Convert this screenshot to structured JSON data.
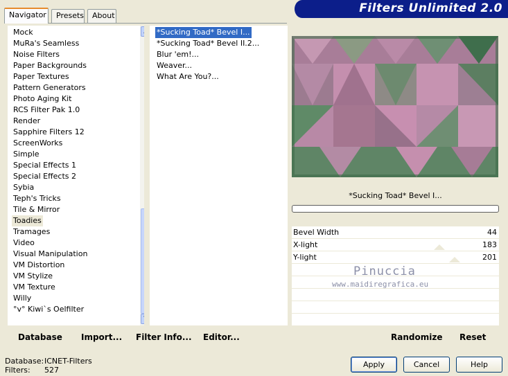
{
  "tabs": [
    {
      "label": "Navigator"
    },
    {
      "label": "Presets"
    },
    {
      "label": "About"
    }
  ],
  "app_title": "Filters Unlimited 2.0",
  "categories": [
    "Mock",
    "MuRa's Seamless",
    "Noise Filters",
    "Paper Backgrounds",
    "Paper Textures",
    "Pattern Generators",
    "Photo Aging Kit",
    "RCS Filter Pak 1.0",
    "Render",
    "Sapphire Filters 12",
    "ScreenWorks",
    "Simple",
    "Special Effects 1",
    "Special Effects 2",
    "Sybia",
    "Teph's Tricks",
    "Tile & Mirror",
    "Toadies",
    "Tramages",
    "Video",
    "Visual Manipulation",
    "VM Distortion",
    "VM Stylize",
    "VM Texture",
    "Willy",
    "°v° Kiwi`s Oelfilter"
  ],
  "selected_category": "Toadies",
  "filters": [
    "*Sucking Toad*  Bevel I...",
    "*Sucking Toad*  Bevel II.2...",
    "Blur 'em!...",
    "Weaver...",
    "What Are You?..."
  ],
  "preview_title": "*Sucking Toad*  Bevel I...",
  "params": [
    {
      "label": "Bevel Width",
      "value": "44"
    },
    {
      "label": "X-light",
      "value": "183"
    },
    {
      "label": "Y-light",
      "value": "201"
    }
  ],
  "watermark": {
    "line1": "Pinuccia",
    "line2": "www.maidiregrafica.eu"
  },
  "toolbar": {
    "database": "Database",
    "import": "Import...",
    "filter_info": "Filter Info...",
    "editor": "Editor...",
    "randomize": "Randomize",
    "reset": "Reset"
  },
  "status": {
    "database_label": "Database:",
    "database_value": "ICNET-Filters",
    "filters_label": "Filters:",
    "filters_value": "527"
  },
  "buttons": {
    "apply": "Apply",
    "cancel": "Cancel",
    "help": "Help"
  },
  "colors": {
    "selection": "#316ac5",
    "banner": "#0c1e8a"
  }
}
